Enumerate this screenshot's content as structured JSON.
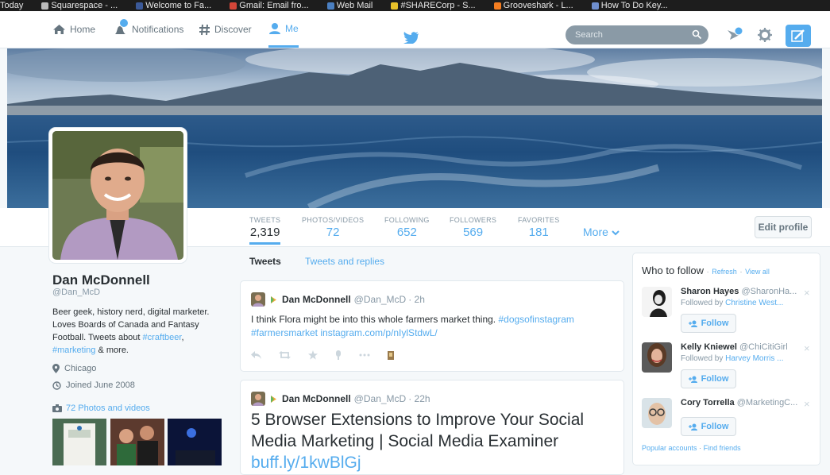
{
  "bookmarks": [
    {
      "label": "Today",
      "color": "#ffffff"
    },
    {
      "label": "Squarespace - ...",
      "color": "#b9b9b9"
    },
    {
      "label": "Welcome to Fa...",
      "color": "#3b5998"
    },
    {
      "label": "Gmail: Email fro...",
      "color": "#d44638"
    },
    {
      "label": "Web Mail",
      "color": "#4a7fc1"
    },
    {
      "label": "#SHARECorp - S...",
      "color": "#e8c12a"
    },
    {
      "label": "Grooveshark - L...",
      "color": "#f47d20"
    },
    {
      "label": "How To Do Key...",
      "color": "#6f8fcf"
    }
  ],
  "nav": {
    "home": "Home",
    "notifications": "Notifications",
    "discover": "Discover",
    "me": "Me",
    "search_placeholder": "Search"
  },
  "colors": {
    "accent": "#55acee",
    "text": "#292f33",
    "muted": "#8899a6"
  },
  "stats": [
    {
      "label": "TWEETS",
      "value": "2,319"
    },
    {
      "label": "PHOTOS/VIDEOS",
      "value": "72"
    },
    {
      "label": "FOLLOWING",
      "value": "652"
    },
    {
      "label": "FOLLOWERS",
      "value": "569"
    },
    {
      "label": "FAVORITES",
      "value": "181"
    }
  ],
  "more_label": "More",
  "edit_profile": "Edit profile",
  "profile": {
    "name": "Dan McDonnell",
    "handle": "@Dan_McD",
    "bio_text": "Beer geek, history nerd, digital marketer. Loves Boards of Canada and Fantasy Football. Tweets about ",
    "bio_tag1": "#craftbeer",
    "bio_sep": ", ",
    "bio_tag2": "#marketing",
    "bio_end": " & more.",
    "location": "Chicago",
    "joined": "Joined June 2008",
    "photos_link": "72 Photos and videos"
  },
  "tabs": {
    "tweets": "Tweets",
    "replies": "Tweets and replies"
  },
  "tweets": [
    {
      "name": "Dan McDonnell",
      "handle": "@Dan_McD",
      "time": "· 2h",
      "text": "I think Flora might be into this whole farmers market thing. ",
      "link1": "#dogsofinstagram",
      "link2": "#farmersmarket instagram.com/p/nIylStdwL/"
    },
    {
      "name": "Dan McDonnell",
      "handle": "@Dan_McD",
      "time": "· 22h",
      "text": "5 Browser Extensions to Improve Your Social Media Marketing | Social Media Examiner ",
      "link1": "buff.ly/1kwBlGj"
    }
  ],
  "who_to_follow": {
    "title": "Who to follow",
    "refresh": "Refresh",
    "view_all": "View all",
    "follow_label": "Follow",
    "suggestions": [
      {
        "name": "Sharon Hayes",
        "handle": "@SharonHa...",
        "by_prefix": "Followed by",
        "by": "Christine West..."
      },
      {
        "name": "Kelly Kniewel",
        "handle": "@ChiCitiGirl",
        "by_prefix": "Followed by",
        "by": "Harvey Morris ..."
      },
      {
        "name": "Cory Torrella",
        "handle": "@MarketingC...",
        "by_prefix": "",
        "by": ""
      }
    ],
    "footer_popular": "Popular accounts",
    "footer_find": "Find friends"
  }
}
